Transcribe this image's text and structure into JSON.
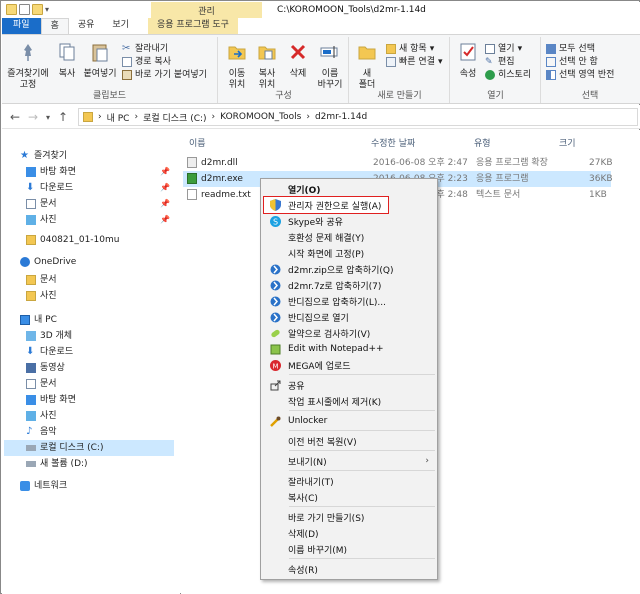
{
  "window": {
    "title_path": "C:\\KOROMOON_Tools\\d2mr-1.14d",
    "manage_label": "관리"
  },
  "ribbon_tabs": [
    "파일",
    "홈",
    "공유",
    "보기",
    "응용 프로그램 도구"
  ],
  "ribbon": {
    "clipboard": {
      "pin_label": "즐겨찾기에\n고정",
      "copy_label": "복사",
      "paste_label": "붙여넣기",
      "cut_label": "잘라내기",
      "copy_path_label": "경로 복사",
      "paste_shortcut_label": "바로 가기 붙여넣기",
      "group_label": "클립보드"
    },
    "organize": {
      "move_label": "이동\n위치",
      "copyto_label": "복사\n위치",
      "delete_label": "삭제",
      "rename_label": "이름\n바꾸기",
      "group_label": "구성"
    },
    "new": {
      "folder_label": "새\n폴더",
      "new_item_label": "새 항목",
      "easy_access_label": "빠른 연결",
      "group_label": "새로 만들기"
    },
    "open": {
      "properties_label": "속성",
      "open_label": "열기",
      "edit_label": "편집",
      "history_label": "히스토리",
      "group_label": "열기"
    },
    "select": {
      "select_all_label": "모두 선택",
      "select_none_label": "선택 안 함",
      "invert_label": "선택 영역 반전",
      "group_label": "선택"
    }
  },
  "breadcrumb": [
    "내 PC",
    "로컬 디스크 (C:)",
    "KOROMOON_Tools",
    "d2mr-1.14d"
  ],
  "nav": {
    "quick_access": "즐겨찾기",
    "quick_items": [
      "바탕 화면",
      "다운로드",
      "문서",
      "사진",
      "040821_01-10mu"
    ],
    "onedrive": "OneDrive",
    "onedrive_items": [
      "문서",
      "사진"
    ],
    "this_pc": "내 PC",
    "pc_items": [
      "3D 개체",
      "다운로드",
      "동영상",
      "문서",
      "바탕 화면",
      "사진",
      "음악",
      "로컬 디스크 (C:)",
      "새 볼륨 (D:)"
    ],
    "network": "네트워크"
  },
  "columns": {
    "name": "이름",
    "date": "수정한 날짜",
    "type": "유형",
    "size": "크기"
  },
  "files": [
    {
      "name": "d2mr.dll",
      "date": "2016-06-08 오후 2:47",
      "type": "응용 프로그램 확장",
      "size": "27KB"
    },
    {
      "name": "d2mr.exe",
      "date": "2016-06-08 오후 2:23",
      "type": "응용 프로그램",
      "size": "36KB"
    },
    {
      "name": "readme.txt",
      "date": "2016-06-08 오후 2:48",
      "type": "텍스트 문서",
      "size": "1KB"
    }
  ],
  "context_menu": [
    {
      "label": "열기(O)",
      "icon": "none",
      "bold": true
    },
    {
      "label": "관리자 권한으로 실행(A)",
      "icon": "shield-icon"
    },
    {
      "label": "Skype와 공유",
      "icon": "skype-icon"
    },
    {
      "label": "호환성 문제 해결(Y)",
      "icon": "none"
    },
    {
      "label": "시작 화면에 고정(P)",
      "icon": "none"
    },
    {
      "label": "d2mr.zip으로 압축하기(Q)",
      "icon": "bandizip-icon"
    },
    {
      "label": "d2mr.7z로 압축하기(7)",
      "icon": "bandizip-icon"
    },
    {
      "label": "반디집으로 압축하기(L)...",
      "icon": "bandizip-icon"
    },
    {
      "label": "반디집으로 열기",
      "icon": "bandizip-icon"
    },
    {
      "label": "알약으로 검사하기(V)",
      "icon": "alyac-icon"
    },
    {
      "label": "Edit with Notepad++",
      "icon": "notepad-icon"
    },
    {
      "label": "MEGA에 업로드",
      "icon": "mega-icon"
    },
    {
      "label": "공유",
      "icon": "share-icon"
    },
    {
      "label": "작업 표시줄에서 제거(K)",
      "icon": "none"
    },
    {
      "label": "Unlocker",
      "icon": "unlocker-icon"
    },
    {
      "label": "이전 버전 복원(V)",
      "icon": "none"
    },
    {
      "label": "보내기(N)",
      "icon": "none"
    },
    {
      "label": "잘라내기(T)",
      "icon": "none"
    },
    {
      "label": "복사(C)",
      "icon": "none"
    },
    {
      "label": "바로 가기 만들기(S)",
      "icon": "none"
    },
    {
      "label": "삭제(D)",
      "icon": "none"
    },
    {
      "label": "이름 바꾸기(M)",
      "icon": "none"
    },
    {
      "label": "속성(R)",
      "icon": "none"
    }
  ],
  "colors": {
    "accent": "#1a6dc9",
    "selection": "#cce8ff",
    "highlight_box": "#e02020",
    "manage_tab": "#f8e7a8"
  }
}
